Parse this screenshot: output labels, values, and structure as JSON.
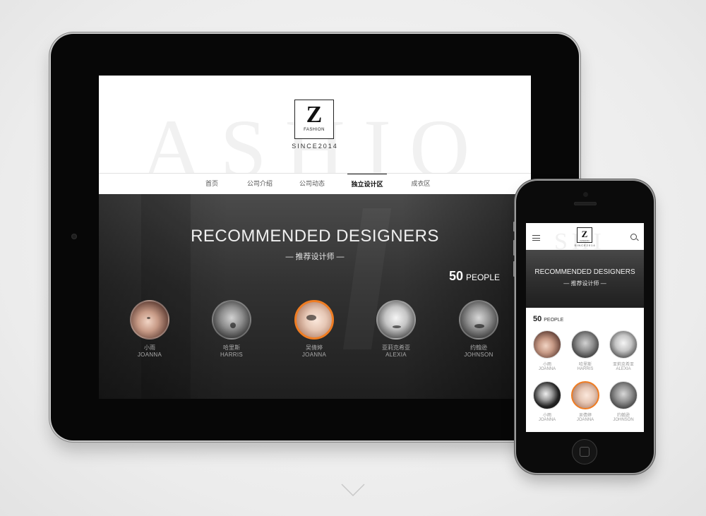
{
  "brand": {
    "logo_letter": "Z",
    "logo_sub": "FASHION",
    "since": "SINCE2014",
    "watermark": "ASHIO",
    "phone_watermark": "SHI"
  },
  "nav": {
    "items": [
      {
        "label": "首页",
        "active": false
      },
      {
        "label": "公司介绍",
        "active": false
      },
      {
        "label": "公司动态",
        "active": false
      },
      {
        "label": "独立设计区",
        "active": true
      },
      {
        "label": "成衣区",
        "active": false
      }
    ]
  },
  "hero": {
    "title": "RECOMMENDED DESIGNERS",
    "subtitle": "— 推荐设计师 —"
  },
  "count": {
    "number": "50",
    "label": "PEOPLE"
  },
  "designers": [
    {
      "cn": "小雨",
      "en": "JOANNA",
      "selected": false
    },
    {
      "cn": "哈里斯",
      "en": "HARRIS",
      "selected": false
    },
    {
      "cn": "吴倩婷",
      "en": "JOANNA",
      "selected": true
    },
    {
      "cn": "亚莉克希亚",
      "en": "ALEXIA",
      "selected": false
    },
    {
      "cn": "约翰逊",
      "en": "JOHNSON",
      "selected": false
    }
  ],
  "phone_designers": [
    {
      "cn": "小雨",
      "en": "JOANNA",
      "selected": false
    },
    {
      "cn": "哈里斯",
      "en": "HARRIS",
      "selected": false
    },
    {
      "cn": "亚莉克希亚",
      "en": "ALEXIA",
      "selected": false
    },
    {
      "cn": "小雨",
      "en": "JOANNA",
      "selected": false
    },
    {
      "cn": "吴倩婷",
      "en": "JOANNA",
      "selected": true
    },
    {
      "cn": "约翰逊",
      "en": "JOHNSON",
      "selected": false
    }
  ],
  "colors": {
    "accent": "#ef7d23",
    "hero_bg": "#333333",
    "bezel": "#070707"
  },
  "icons": {
    "menu": "hamburger-menu-icon",
    "search": "search-icon",
    "scroll": "chevron-down-icon"
  }
}
